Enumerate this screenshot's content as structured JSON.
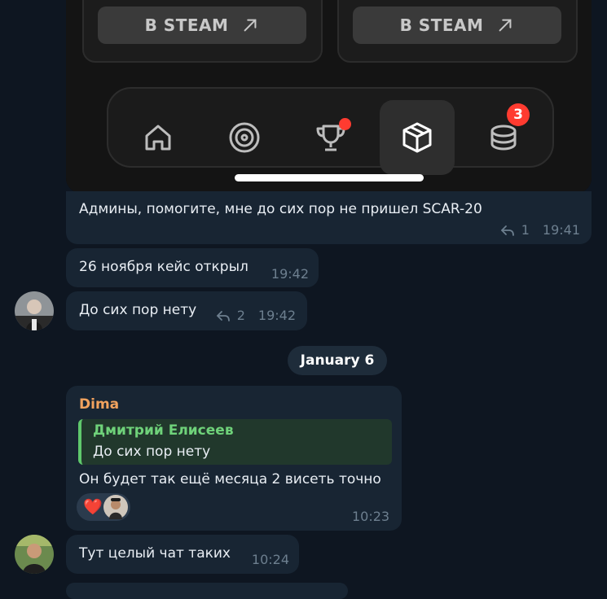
{
  "media": {
    "steam_left_label": "В STEAM",
    "steam_right_label": "В STEAM",
    "nav": {
      "items": [
        "home-icon",
        "disc-icon",
        "trophy-icon",
        "box-icon",
        "coins-icon"
      ],
      "active_index": 3,
      "trophy_has_dot": true,
      "coins_badge": "3"
    }
  },
  "messages": [
    {
      "text": "Админы, помогите, мне до сих пор не пришел SCAR-20",
      "reply_count": "1",
      "time": "19:41"
    },
    {
      "text": "26 ноября кейс открыл",
      "time": "19:42"
    },
    {
      "text": "До сих пор нету",
      "reply_count": "2",
      "time": "19:42"
    }
  ],
  "date_separator": "January 6",
  "reply_message": {
    "sender": "Dima",
    "quote_author": "Дмитрий Елисеев",
    "quote_text": "До сих пор нету",
    "text": "Он будет так ещё месяца 2 висеть точно",
    "reaction": "❤️",
    "time": "10:23"
  },
  "last_message": {
    "text": "Тут целый чат таких",
    "time": "10:24"
  },
  "colors": {
    "background": "#0e1621",
    "bubble": "#182533",
    "sender_name": "#f1a25e",
    "quote_accent": "#5fc86c",
    "meta": "#6d7f8f",
    "badge": "#ff3b30"
  }
}
